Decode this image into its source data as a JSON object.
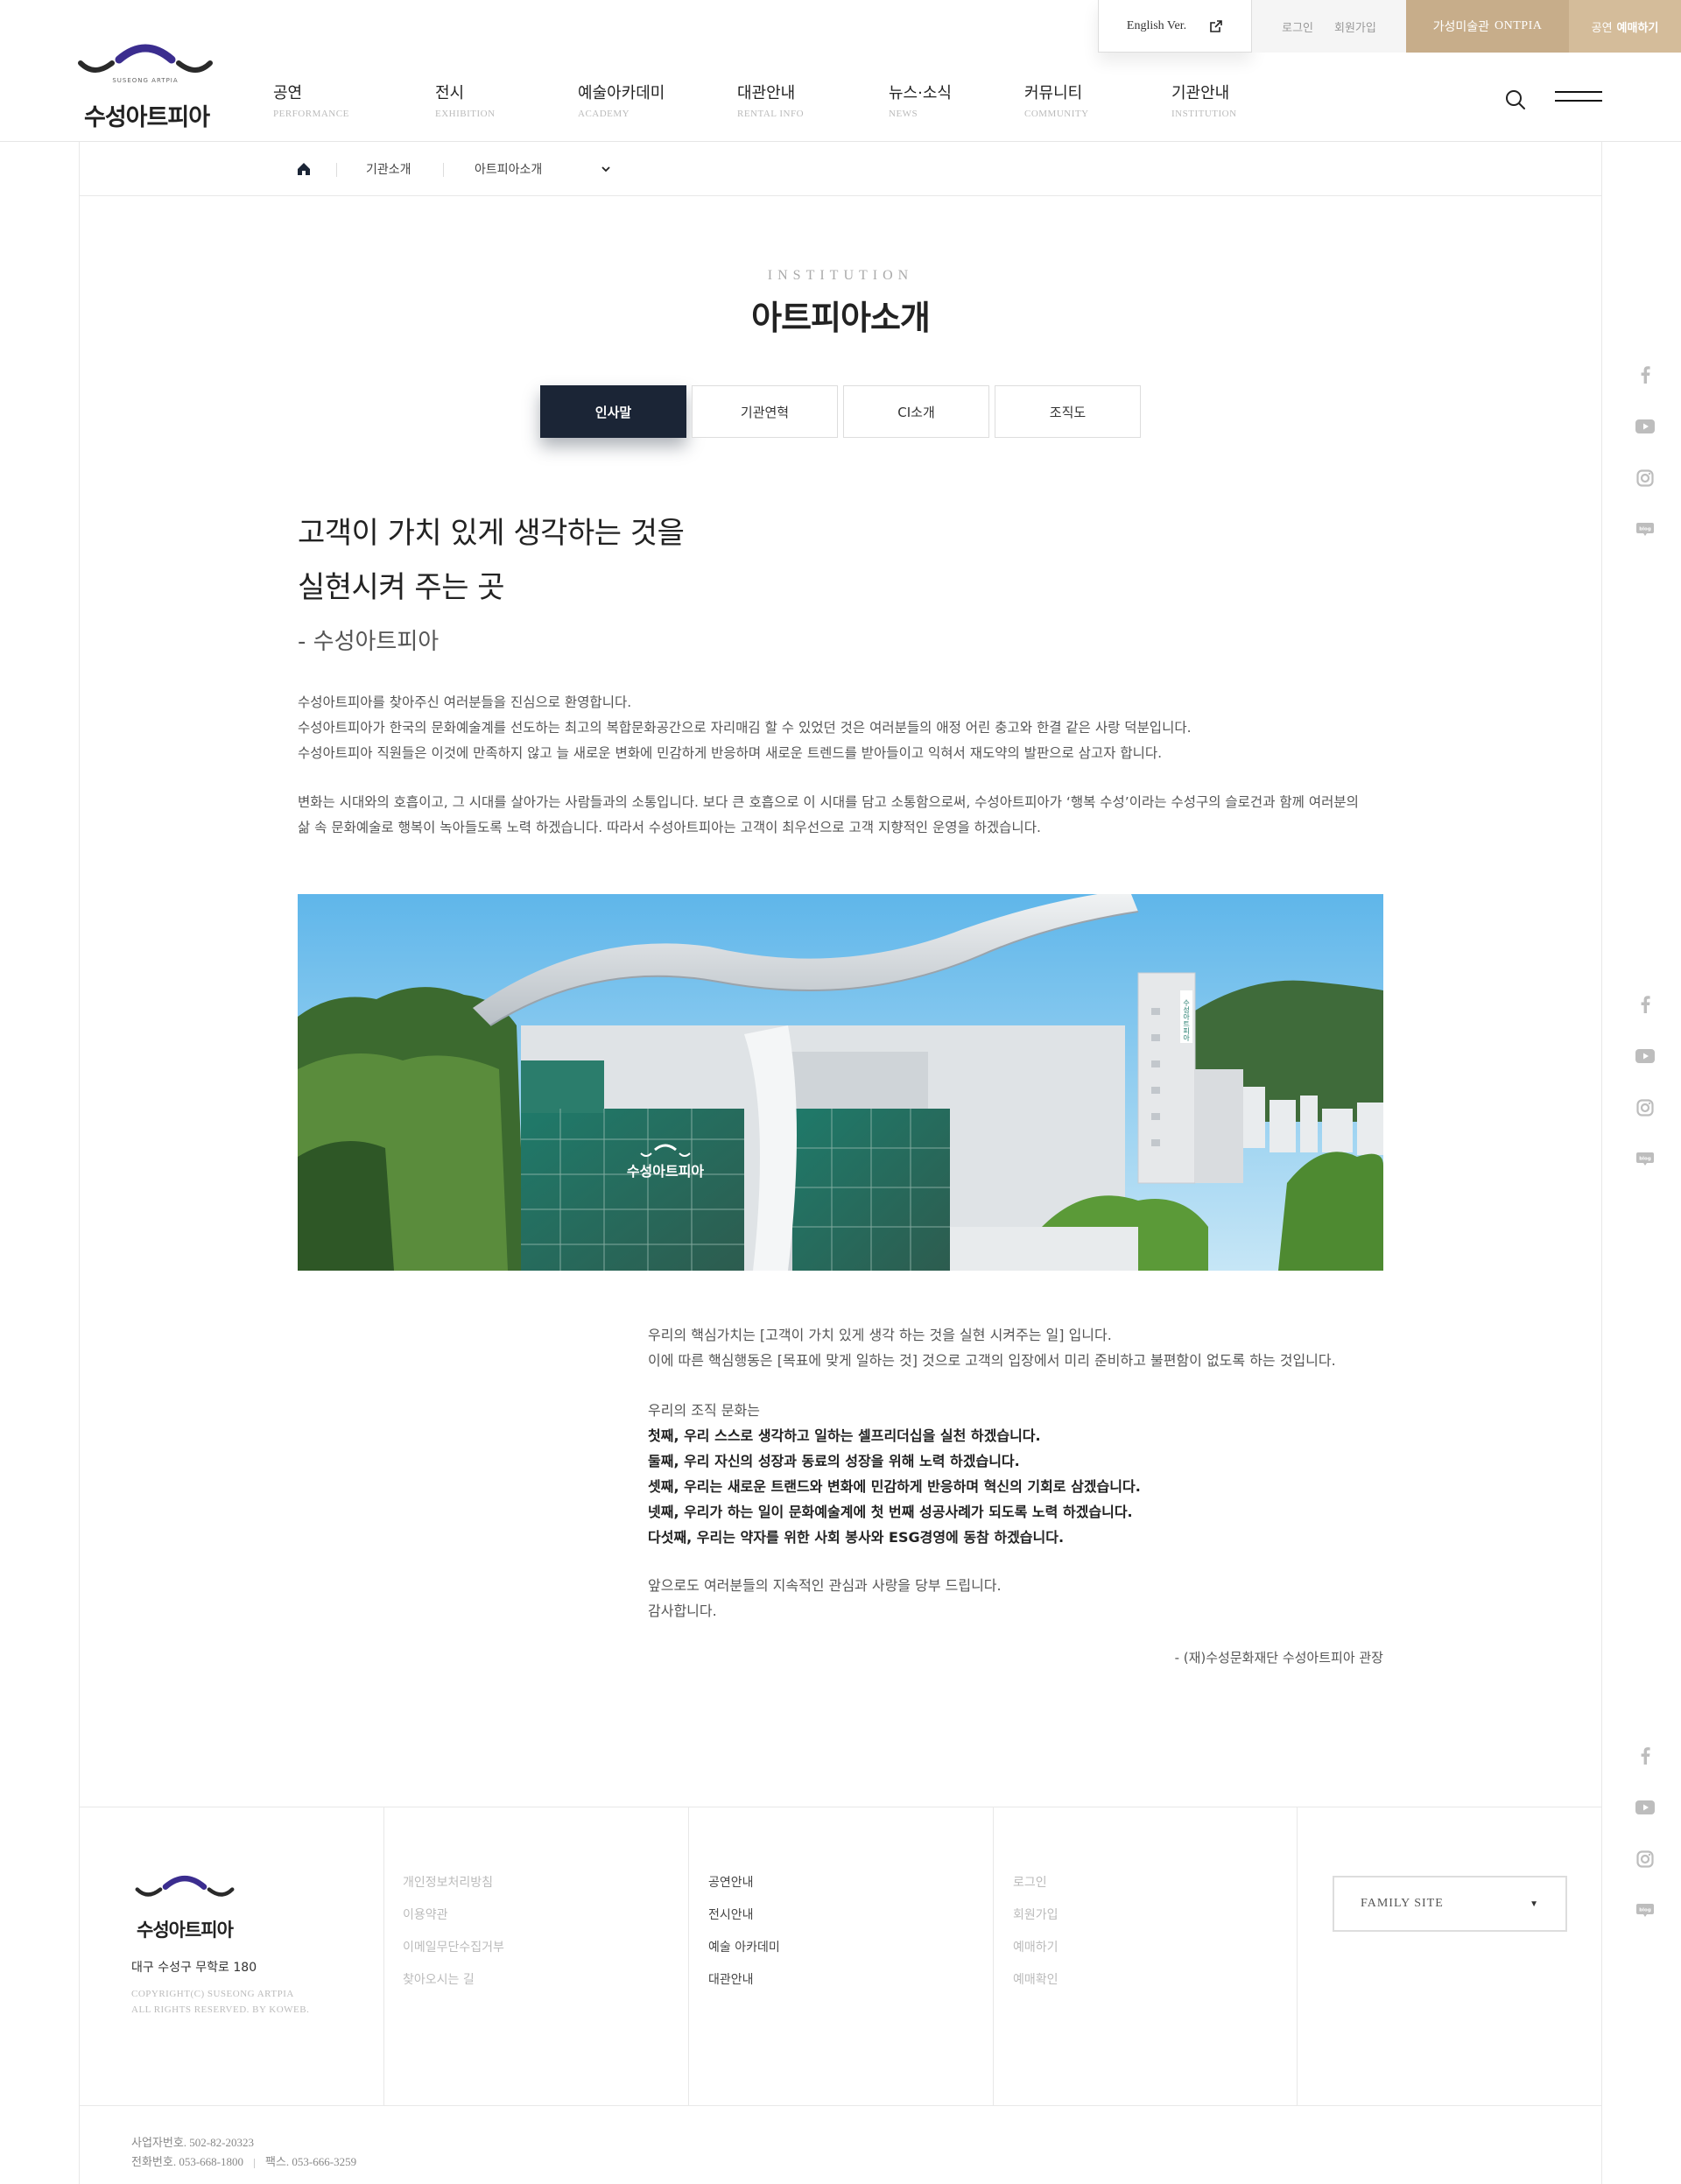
{
  "util": {
    "english": "English Ver.",
    "login": "로그인",
    "join": "회원가입",
    "ontpia_prefix": "가성미술관",
    "ontpia_name": "ONTPIA",
    "ticket_prefix": "공연",
    "ticket_name": "예매하기"
  },
  "logo": {
    "name": "수성아트피아",
    "tagline": "SUSEONG ARTPIA"
  },
  "gnb": [
    {
      "ko": "공연",
      "en": "PERFORMANCE"
    },
    {
      "ko": "전시",
      "en": "EXHIBITION"
    },
    {
      "ko": "예술아카데미",
      "en": "ACADEMY"
    },
    {
      "ko": "대관안내",
      "en": "RENTAL INFO"
    },
    {
      "ko": "뉴스·소식",
      "en": "NEWS"
    },
    {
      "ko": "커뮤니티",
      "en": "COMMUNITY"
    },
    {
      "ko": "기관안내",
      "en": "INSTITUTION"
    }
  ],
  "breadcrumb": {
    "level1": "기관소개",
    "level2": "아트피아소개"
  },
  "page": {
    "subhead": "INSTITUTION",
    "title": "아트피아소개"
  },
  "tabs": [
    {
      "label": "인사말",
      "active": true
    },
    {
      "label": "기관연혁",
      "active": false
    },
    {
      "label": "CI소개",
      "active": false
    },
    {
      "label": "조직도",
      "active": false
    }
  ],
  "greeting": {
    "slogan_line1": "고객이 가치 있게 생각하는 것을",
    "slogan_line2": "실현시켜 주는 곳",
    "signature_top": "- 수성아트피아",
    "p1_line1": "수성아트피아를 찾아주신 여러분들을 진심으로 환영합니다.",
    "p1_line2": "수성아트피아가 한국의 문화예술계를 선도하는 최고의 복합문화공간으로 자리매김 할 수 있었던 것은 여러분들의 애정 어린 충고와 한결 같은 사랑 덕분입니다.",
    "p1_line3": "수성아트피아 직원들은 이것에 만족하지 않고 늘 새로운 변화에 민감하게 반응하며 새로운 트렌드를 받아들이고 익혀서 재도약의 발판으로 삼고자 합니다.",
    "p2_line1": "변화는 시대와의 호흡이고, 그 시대를 살아가는 사람들과의 소통입니다. 보다 큰 호흡으로 이 시대를 담고 소통함으로써, 수성아트피아가 ‘행복 수성’이라는 수성구의 슬로건과 함께 여러분의",
    "p2_line2": "삶 속 문화예술로 행복이 녹아들도록 노력 하겠습니다. 따라서 수성아트피아는 고객이 최우선으로 고객 지향적인 운영을 하겠습니다."
  },
  "values": {
    "v1_line1": "우리의 핵심가치는 [고객이 가치 있게 생각 하는 것을 실현 시켜주는 일] 입니다.",
    "v1_line2": "이에 따른 핵심행동은 [목표에 맞게 일하는 것] 것으로 고객의 입장에서 미리 준비하고 불편함이 없도록 하는 것입니다.",
    "culture_intro": "우리의 조직 문화는",
    "c1": "첫째, 우리 스스로 생각하고 일하는 셀프리더십을 실천 하겠습니다.",
    "c2": "둘째, 우리 자신의 성장과 동료의 성장을 위해 노력 하겠습니다.",
    "c3": "셋째, 우리는 새로운 트랜드와 변화에 민감하게 반응하며 혁신의 기회로 삼겠습니다.",
    "c4": "넷째, 우리가 하는 일이 문화예술계에 첫 번째 성공사례가 되도록 노력 하겠습니다.",
    "c5": "다섯째, 우리는 약자를 위한 사회 봉사와 ESG경영에 동참 하겠습니다.",
    "closing1": "앞으로도 여러분들의 지속적인 관심과 사랑을 당부 드립니다.",
    "closing2": "감사합니다.",
    "signature": "- (재)수성문화재단 수성아트피아 관장"
  },
  "photo": {
    "sign_text": "수성아트피아",
    "building_sign": "수성아트피아"
  },
  "footer": {
    "address": "대구 수성구 무학로 180",
    "copy_line1": "COPYRIGHT(C) SUSEONG ARTPIA",
    "copy_line2": "ALL RIGHTS RESERVED. BY KOWEB.",
    "links1": [
      "개인정보처리방침",
      "이용약관",
      "이메일무단수집거부",
      "찾아오시는 길"
    ],
    "links2": [
      "공연안내",
      "전시안내",
      "예술 아카데미",
      "대관안내"
    ],
    "links3": [
      "로그인",
      "회원가입",
      "예매하기",
      "예매확인"
    ],
    "family_site": "FAMILY SITE",
    "biz_no": "사업자번호. 502-82-20323",
    "tel": "전화번호. 053-668-1800",
    "fax": "팩스. 053-666-3259"
  },
  "colors": {
    "navy": "#1b2536",
    "gold": "#c7ad8a",
    "logo_purple": "#3b2d8f"
  },
  "social_icons": [
    "facebook-icon",
    "youtube-icon",
    "instagram-icon",
    "blog-icon"
  ]
}
